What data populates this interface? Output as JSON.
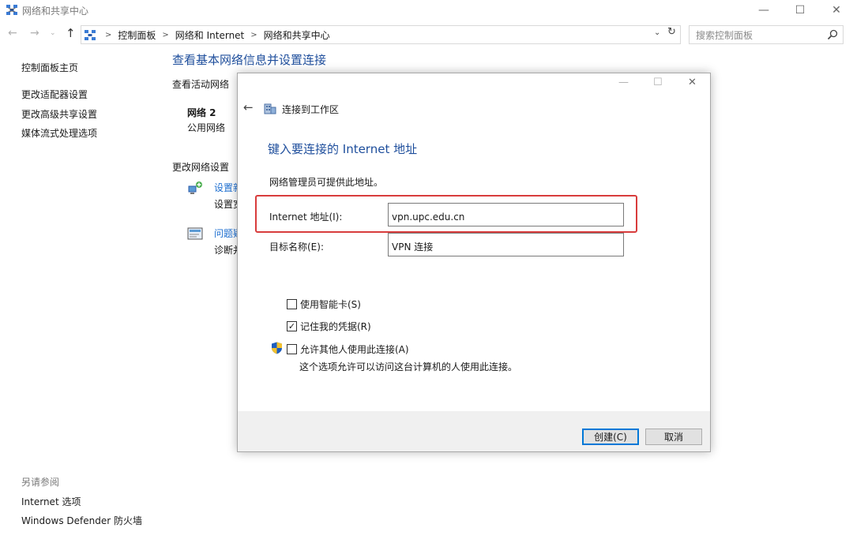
{
  "window": {
    "title": "网络和共享中心",
    "min": "—",
    "max": "☐",
    "close": "✕"
  },
  "nav": {
    "back": "←",
    "forward": "→",
    "recent": "⌄",
    "up": "↑",
    "breadcrumbs": [
      "控制面板",
      "网络和 Internet",
      "网络和共享中心"
    ],
    "dropdown": "⌄",
    "refresh": "↻",
    "search_placeholder": "搜索控制面板"
  },
  "sidebar": {
    "home": "控制面板主页",
    "links": [
      "更改适配器设置",
      "更改高级共享设置",
      "媒体流式处理选项"
    ],
    "see_also_title": "另请参阅",
    "see_also": [
      "Internet 选项",
      "Windows Defender 防火墙"
    ]
  },
  "main": {
    "title": "查看基本网络信息并设置连接",
    "active_label": "查看活动网络",
    "network_name": "网络 2",
    "network_type": "公用网络",
    "change_label": "更改网络设置",
    "setting1_title": "设置新",
    "setting1_desc": "设置宽",
    "setting2_title": "问题疑",
    "setting2_desc": "诊断并"
  },
  "dialog": {
    "min": "—",
    "max": "☐",
    "close": "✕",
    "back": "←",
    "caption": "连接到工作区",
    "heading": "键入要连接的 Internet 地址",
    "note": "网络管理员可提供此地址。",
    "address_label": "Internet 地址(I):",
    "address_value": "vpn.upc.edu.cn",
    "name_label": "目标名称(E):",
    "name_value": "VPN 连接",
    "smartcard": {
      "label": "使用智能卡(S)",
      "checked": false
    },
    "remember": {
      "label": "记住我的凭据(R)",
      "checked": true,
      "mark": "✓"
    },
    "allow": {
      "label": "允许其他人使用此连接(A)",
      "checked": false
    },
    "allow_desc": "这个选项允许可以访问这台计算机的人使用此连接。",
    "create_button": "创建(C)",
    "cancel_button": "取消"
  },
  "colors": {
    "heading": "#1e4e9c",
    "link": "#1e6fd0",
    "highlight": "#d83c3c",
    "primary_border": "#0078d7"
  }
}
